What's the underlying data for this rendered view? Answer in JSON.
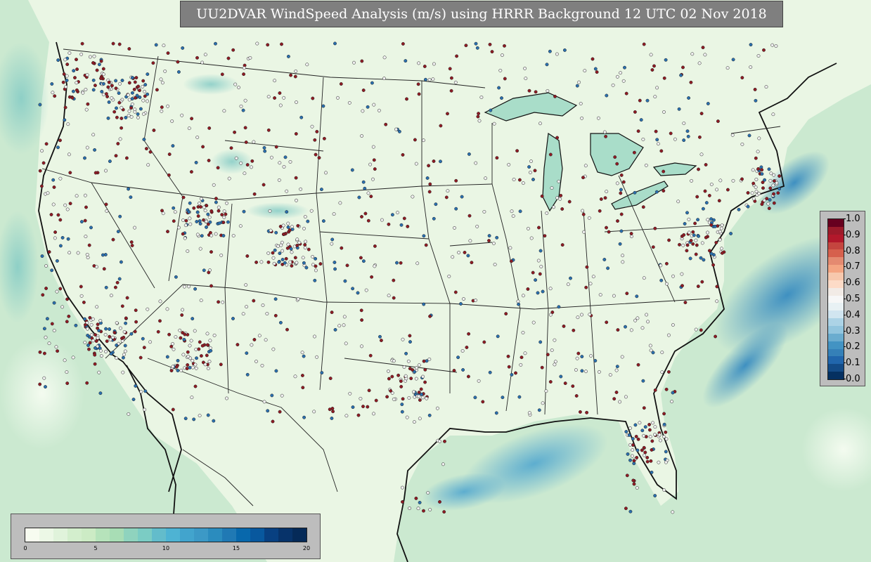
{
  "title": "UU2DVAR WindSpeed Analysis (m/s) using HRRR Background 12 UTC 02 Nov 2018",
  "score_legend": {
    "ticks": [
      "1.0",
      "0.9",
      "0.8",
      "0.7",
      "0.6",
      "0.5",
      "0.4",
      "0.3",
      "0.2",
      "0.1",
      "0.0"
    ],
    "colors": [
      "#67001f",
      "#9c1a2a",
      "#b2182b",
      "#c4453f",
      "#d6604d",
      "#e48a70",
      "#f4a582",
      "#f7c8ad",
      "#fddbc7",
      "#f2ebe6",
      "#f7f7f7",
      "#e8f1f4",
      "#d1e5f0",
      "#acd3e6",
      "#92c5de",
      "#6aaccf",
      "#4393c3",
      "#3580b8",
      "#2166ac",
      "#134b87",
      "#053061"
    ]
  },
  "speed_legend": {
    "ticks": [
      "0",
      "5",
      "10",
      "15",
      "20"
    ],
    "colors": [
      "#f7fcf0",
      "#ecf8e6",
      "#e0f3db",
      "#d3eecd",
      "#ccebc5",
      "#b6e3bb",
      "#a8ddb5",
      "#8fd3be",
      "#7bccc4",
      "#63bccb",
      "#4eb3d3",
      "#42a4cd",
      "#3c99c6",
      "#2b8cbe",
      "#2079b4",
      "#0868ac",
      "#08589e",
      "#084081",
      "#07336a",
      "#052a58"
    ]
  },
  "colors": {
    "land": "#eaf6e4",
    "ocean": "#cbe9d0",
    "station_high": "#8e1b24",
    "station_low": "#2a6fae",
    "station_neutral": "#f0f0f0"
  }
}
